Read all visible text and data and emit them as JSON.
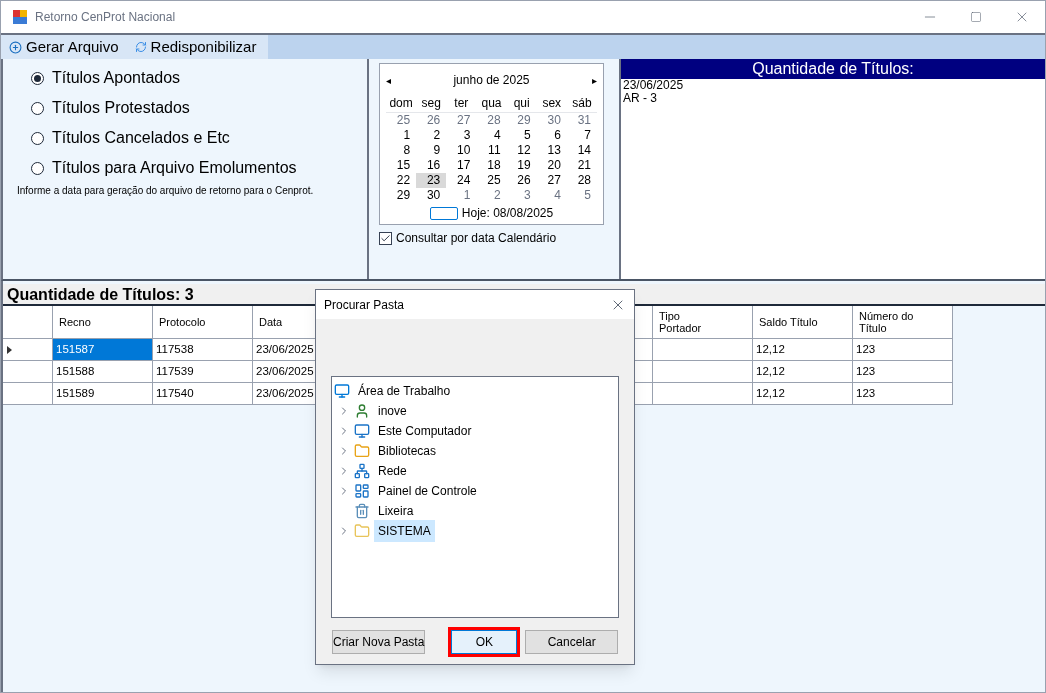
{
  "window": {
    "title": "Retorno CenProt Nacional"
  },
  "toolbar": [
    {
      "kind": "add",
      "label": "Gerar Arquivo"
    },
    {
      "kind": "refresh",
      "label": "Redisponibilizar"
    }
  ],
  "options": [
    {
      "label": "Títulos Apontados",
      "selected": true
    },
    {
      "label": "Títulos Protestados",
      "selected": false
    },
    {
      "label": "Títulos Cancelados e Etc",
      "selected": false
    },
    {
      "label": "Títulos para Arquivo Emolumentos",
      "selected": false
    }
  ],
  "hint": "Informe a data para geração do arquivo de retorno para o Cenprot.",
  "calendar": {
    "month": "junho de 2025",
    "prev": "◂",
    "next": "▸",
    "weekdays": [
      "dom",
      "seg",
      "ter",
      "qua",
      "qui",
      "sex",
      "sáb"
    ],
    "weeks": [
      [
        {
          "day": "25",
          "other_month": true,
          "selected": false
        },
        {
          "day": "26",
          "other_month": true,
          "selected": false
        },
        {
          "day": "27",
          "other_month": true,
          "selected": false
        },
        {
          "day": "28",
          "other_month": true,
          "selected": false
        },
        {
          "day": "29",
          "other_month": true,
          "selected": false
        },
        {
          "day": "30",
          "other_month": true,
          "selected": false
        },
        {
          "day": "31",
          "other_month": true,
          "selected": false
        }
      ],
      [
        {
          "day": "1",
          "other_month": false,
          "selected": false
        },
        {
          "day": "2",
          "other_month": false,
          "selected": false
        },
        {
          "day": "3",
          "other_month": false,
          "selected": false
        },
        {
          "day": "4",
          "other_month": false,
          "selected": false
        },
        {
          "day": "5",
          "other_month": false,
          "selected": false
        },
        {
          "day": "6",
          "other_month": false,
          "selected": false
        },
        {
          "day": "7",
          "other_month": false,
          "selected": false
        }
      ],
      [
        {
          "day": "8",
          "other_month": false,
          "selected": false
        },
        {
          "day": "9",
          "other_month": false,
          "selected": false
        },
        {
          "day": "10",
          "other_month": false,
          "selected": false
        },
        {
          "day": "11",
          "other_month": false,
          "selected": false
        },
        {
          "day": "12",
          "other_month": false,
          "selected": false
        },
        {
          "day": "13",
          "other_month": false,
          "selected": false
        },
        {
          "day": "14",
          "other_month": false,
          "selected": false
        }
      ],
      [
        {
          "day": "15",
          "other_month": false,
          "selected": false
        },
        {
          "day": "16",
          "other_month": false,
          "selected": false
        },
        {
          "day": "17",
          "other_month": false,
          "selected": false
        },
        {
          "day": "18",
          "other_month": false,
          "selected": false
        },
        {
          "day": "19",
          "other_month": false,
          "selected": false
        },
        {
          "day": "20",
          "other_month": false,
          "selected": false
        },
        {
          "day": "21",
          "other_month": false,
          "selected": false
        }
      ],
      [
        {
          "day": "22",
          "other_month": false,
          "selected": false
        },
        {
          "day": "23",
          "other_month": false,
          "selected": true
        },
        {
          "day": "24",
          "other_month": false,
          "selected": false
        },
        {
          "day": "25",
          "other_month": false,
          "selected": false
        },
        {
          "day": "26",
          "other_month": false,
          "selected": false
        },
        {
          "day": "27",
          "other_month": false,
          "selected": false
        },
        {
          "day": "28",
          "other_month": false,
          "selected": false
        }
      ],
      [
        {
          "day": "29",
          "other_month": false,
          "selected": false
        },
        {
          "day": "30",
          "other_month": false,
          "selected": false
        },
        {
          "day": "1",
          "other_month": true,
          "selected": false
        },
        {
          "day": "2",
          "other_month": true,
          "selected": false
        },
        {
          "day": "3",
          "other_month": true,
          "selected": false
        },
        {
          "day": "4",
          "other_month": true,
          "selected": false
        },
        {
          "day": "5",
          "other_month": true,
          "selected": false
        }
      ]
    ],
    "today": "Hoje: 08/08/2025"
  },
  "consult": {
    "label": "Consultar por data Calendário",
    "checked": true
  },
  "summary": {
    "title": "Quantidade de Títulos:",
    "lines": [
      "23/06/2025",
      "AR - 3"
    ]
  },
  "grid": {
    "title": "Quantidade de Títulos: 3",
    "columns": [
      {
        "label": "Recno"
      },
      {
        "label": "Protocolo"
      },
      {
        "label": "Data"
      },
      {
        "label": "Tipo Portador"
      },
      {
        "label": "Saldo Título"
      },
      {
        "label": "Número do Título"
      }
    ],
    "rows": [
      {
        "current": true,
        "cells": [
          {
            "text": "151587",
            "selected": true
          },
          {
            "text": "117538",
            "selected": false
          },
          {
            "text": "23/06/2025",
            "selected": false
          },
          {
            "text": "",
            "selected": false
          },
          {
            "text": "12,12",
            "selected": false
          },
          {
            "text": "123",
            "selected": false
          }
        ]
      },
      {
        "current": false,
        "cells": [
          {
            "text": "151588",
            "selected": false
          },
          {
            "text": "117539",
            "selected": false
          },
          {
            "text": "23/06/2025",
            "selected": false
          },
          {
            "text": "",
            "selected": false
          },
          {
            "text": "12,12",
            "selected": false
          },
          {
            "text": "123",
            "selected": false
          }
        ]
      },
      {
        "current": false,
        "cells": [
          {
            "text": "151589",
            "selected": false
          },
          {
            "text": "117540",
            "selected": false
          },
          {
            "text": "23/06/2025",
            "selected": false
          },
          {
            "text": "",
            "selected": false
          },
          {
            "text": "12,12",
            "selected": false
          },
          {
            "text": "123",
            "selected": false
          }
        ]
      }
    ]
  },
  "dialog": {
    "title": "Procurar Pasta",
    "tree": [
      {
        "kind": "desktop",
        "label": "Área de Trabalho",
        "expandable": false,
        "selected": false,
        "children": [
          {
            "kind": "user",
            "label": "inove",
            "expandable": true,
            "selected": false
          },
          {
            "kind": "computer",
            "label": "Este Computador",
            "expandable": true,
            "selected": false
          },
          {
            "kind": "libraries",
            "label": "Bibliotecas",
            "expandable": true,
            "selected": false
          },
          {
            "kind": "network",
            "label": "Rede",
            "expandable": true,
            "selected": false
          },
          {
            "kind": "control-panel",
            "label": "Painel de Controle",
            "expandable": true,
            "selected": false
          },
          {
            "kind": "recycle-bin",
            "label": "Lixeira",
            "expandable": false,
            "selected": false
          },
          {
            "kind": "folder",
            "label": "SISTEMA",
            "expandable": true,
            "selected": true
          }
        ]
      }
    ],
    "buttons": [
      {
        "label": "Criar Nova Pasta",
        "highlighted": false
      },
      {
        "label": "OK",
        "highlighted": true
      },
      {
        "label": "Cancelar",
        "highlighted": false
      }
    ]
  }
}
